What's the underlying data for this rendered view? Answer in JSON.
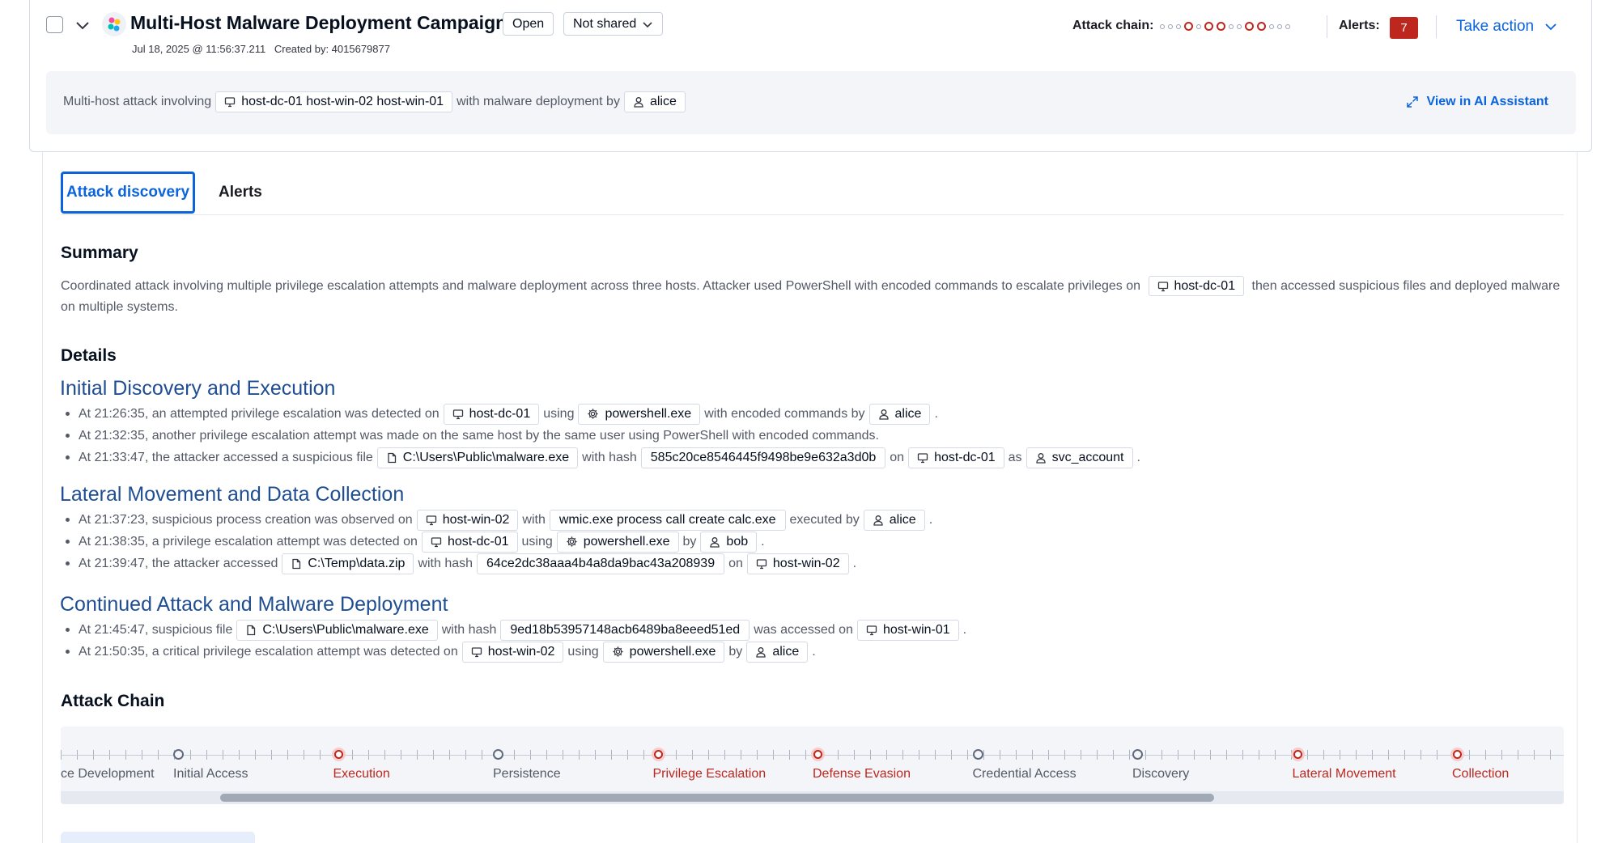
{
  "header": {
    "title": "Multi-Host Malware Deployment Campaign",
    "status_label": "Open",
    "sharing_label": "Not shared",
    "timestamp": "Jul 18, 2025 @ 11:56:37.211",
    "created_by": "Created by: 4015679877",
    "attack_chain_label": "Attack chain:",
    "alerts_label": "Alerts:",
    "alerts_count": "7",
    "take_action_label": "Take action"
  },
  "insight": {
    "prefix": "Multi-host attack involving",
    "hosts_chip": "host-dc-01 host-win-02 host-win-01",
    "middle": "with malware deployment by",
    "user_chip": "alice",
    "ai_link": "View in AI Assistant"
  },
  "tabs": [
    {
      "label": "Attack discovery",
      "active": true
    },
    {
      "label": "Alerts",
      "active": false
    }
  ],
  "summary": {
    "heading": "Summary",
    "text_before": "Coordinated attack involving multiple privilege escalation attempts and malware deployment across three hosts. Attacker used PowerShell with encoded commands to escalate privileges on",
    "host_chip": "host-dc-01",
    "text_after": "then accessed suspicious files and deployed malware on multiple systems."
  },
  "details": {
    "heading": "Details",
    "sections": [
      {
        "title": "Initial Discovery and Execution",
        "bullets": [
          [
            {
              "t": "text",
              "v": "At 21:26:35, an attempted privilege escalation was detected on"
            },
            {
              "t": "host",
              "v": "host-dc-01"
            },
            {
              "t": "text",
              "v": "using"
            },
            {
              "t": "process",
              "v": "powershell.exe"
            },
            {
              "t": "text",
              "v": "with encoded commands by"
            },
            {
              "t": "user",
              "v": "alice"
            },
            {
              "t": "text",
              "v": "."
            }
          ],
          [
            {
              "t": "text",
              "v": "At 21:32:35, another privilege escalation attempt was made on the same host by the same user using PowerShell with encoded commands."
            }
          ],
          [
            {
              "t": "text",
              "v": "At 21:33:47, the attacker accessed a suspicious file"
            },
            {
              "t": "file",
              "v": "C:\\Users\\Public\\malware.exe"
            },
            {
              "t": "text",
              "v": "with hash"
            },
            {
              "t": "plain",
              "v": "585c20ce8546445f9498be9e632a3d0b"
            },
            {
              "t": "text",
              "v": "on"
            },
            {
              "t": "host",
              "v": "host-dc-01"
            },
            {
              "t": "text",
              "v": "as"
            },
            {
              "t": "user",
              "v": "svc_account"
            },
            {
              "t": "text",
              "v": "."
            }
          ]
        ]
      },
      {
        "title": "Lateral Movement and Data Collection",
        "bullets": [
          [
            {
              "t": "text",
              "v": "At 21:37:23, suspicious process creation was observed on"
            },
            {
              "t": "host",
              "v": "host-win-02"
            },
            {
              "t": "text",
              "v": "with"
            },
            {
              "t": "plain",
              "v": "wmic.exe process call create calc.exe"
            },
            {
              "t": "text",
              "v": "executed by"
            },
            {
              "t": "user",
              "v": "alice"
            },
            {
              "t": "text",
              "v": "."
            }
          ],
          [
            {
              "t": "text",
              "v": "At 21:38:35, a privilege escalation attempt was detected on"
            },
            {
              "t": "host",
              "v": "host-dc-01"
            },
            {
              "t": "text",
              "v": "using"
            },
            {
              "t": "process",
              "v": "powershell.exe"
            },
            {
              "t": "text",
              "v": "by"
            },
            {
              "t": "user",
              "v": "bob"
            },
            {
              "t": "text",
              "v": "."
            }
          ],
          [
            {
              "t": "text",
              "v": "At 21:39:47, the attacker accessed"
            },
            {
              "t": "file",
              "v": "C:\\Temp\\data.zip"
            },
            {
              "t": "text",
              "v": "with hash"
            },
            {
              "t": "plain",
              "v": "64ce2dc38aaa4b4a8da9bac43a208939"
            },
            {
              "t": "text",
              "v": "on"
            },
            {
              "t": "host",
              "v": "host-win-02"
            },
            {
              "t": "text",
              "v": "."
            }
          ]
        ]
      },
      {
        "title": "Continued Attack and Malware Deployment",
        "bullets": [
          [
            {
              "t": "text",
              "v": "At 21:45:47, suspicious file"
            },
            {
              "t": "file",
              "v": "C:\\Users\\Public\\malware.exe"
            },
            {
              "t": "text",
              "v": "with hash"
            },
            {
              "t": "plain",
              "v": "9ed18b53957148acb6489ba8eeed51ed"
            },
            {
              "t": "text",
              "v": "was accessed on"
            },
            {
              "t": "host",
              "v": "host-win-01"
            },
            {
              "t": "text",
              "v": "."
            }
          ],
          [
            {
              "t": "text",
              "v": "At 21:50:35, a critical privilege escalation attempt was detected on"
            },
            {
              "t": "host",
              "v": "host-win-02"
            },
            {
              "t": "text",
              "v": "using"
            },
            {
              "t": "process",
              "v": "powershell.exe"
            },
            {
              "t": "text",
              "v": "by"
            },
            {
              "t": "user",
              "v": "alice"
            },
            {
              "t": "text",
              "v": "."
            }
          ]
        ]
      }
    ]
  },
  "attack_chain": {
    "heading": "Attack Chain",
    "mini_indicator": [
      false,
      false,
      false,
      true,
      false,
      true,
      true,
      false,
      false,
      true,
      true,
      false,
      false,
      false
    ],
    "stages": [
      {
        "label": "ce Development",
        "hit": false
      },
      {
        "label": "Initial Access",
        "hit": false
      },
      {
        "label": "Execution",
        "hit": true
      },
      {
        "label": "Persistence",
        "hit": false
      },
      {
        "label": "Privilege Escalation",
        "hit": true
      },
      {
        "label": "Defense Evasion",
        "hit": true
      },
      {
        "label": "Credential Access",
        "hit": false
      },
      {
        "label": "Discovery",
        "hit": false
      },
      {
        "label": "Lateral Movement",
        "hit": true
      },
      {
        "label": "Collection",
        "hit": true
      }
    ]
  },
  "colors": {
    "accent": "#0b64dd",
    "danger": "#bd271e",
    "heading_blue": "#1f4e92"
  },
  "icons": {
    "host": "computer-icon",
    "user": "user-icon",
    "file": "document-icon",
    "process": "gear-icon"
  }
}
